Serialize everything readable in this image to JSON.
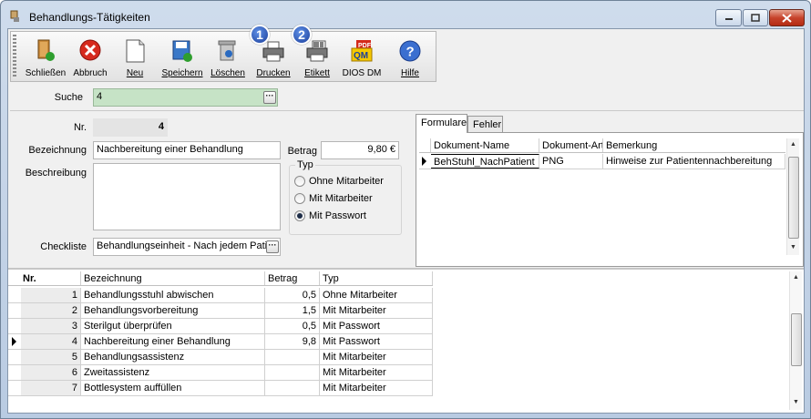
{
  "window": {
    "title": "Behandlungs-Tätigkeiten"
  },
  "toolbar": {
    "items": [
      {
        "label": "Schließen",
        "icon": "close-door-icon"
      },
      {
        "label": "Abbruch",
        "icon": "cancel-icon"
      },
      {
        "label": "Neu",
        "icon": "new-document-icon"
      },
      {
        "label": "Speichern",
        "icon": "save-icon"
      },
      {
        "label": "Löschen",
        "icon": "delete-icon"
      },
      {
        "label": "Drucken",
        "icon": "printer-icon",
        "badge": "1"
      },
      {
        "label": "Etikett",
        "icon": "label-printer-icon",
        "badge": "2"
      },
      {
        "label": "DIOS DM",
        "icon": "pdf-qm-icon"
      },
      {
        "label": "Hilfe",
        "icon": "help-icon"
      }
    ]
  },
  "search": {
    "label": "Suche",
    "value": "4"
  },
  "form": {
    "nr_label": "Nr.",
    "nr_value": "4",
    "bezeichnung_label": "Bezeichnung",
    "bezeichnung_value": "Nachbereitung einer Behandlung",
    "betrag_label": "Betrag",
    "betrag_value": "9,80 €",
    "beschreibung_label": "Beschreibung",
    "beschreibung_value": "",
    "typ_label": "Typ",
    "typ_options": [
      "Ohne Mitarbeiter",
      "Mit Mitarbeiter",
      "Mit Passwort"
    ],
    "typ_selected": "Mit Passwort",
    "checkliste_label": "Checkliste",
    "checkliste_value": "Behandlungseinheit - Nach jedem Patie"
  },
  "doc_tabs": {
    "tabs": [
      "Formulare",
      "Fehler"
    ],
    "active": "Formulare",
    "columns": [
      "Dokument-Name",
      "Dokument-Art",
      "Bemerkung"
    ],
    "rows": [
      {
        "name": "BehStuhl_NachPatient",
        "art": "PNG",
        "bemerkung": "Hinweise zur Patientennachbereitung"
      }
    ]
  },
  "list": {
    "columns": [
      "Nr.",
      "Bezeichnung",
      "Betrag",
      "Typ"
    ],
    "rows": [
      {
        "nr": "1",
        "bez": "Behandlungsstuhl abwischen",
        "betrag": "0,5",
        "typ": "Ohne Mitarbeiter"
      },
      {
        "nr": "2",
        "bez": "Behandlungsvorbereitung",
        "betrag": "1,5",
        "typ": "Mit Mitarbeiter"
      },
      {
        "nr": "3",
        "bez": "Sterilgut überprüfen",
        "betrag": "0,5",
        "typ": "Mit Passwort"
      },
      {
        "nr": "4",
        "bez": "Nachbereitung einer Behandlung",
        "betrag": "9,8",
        "typ": "Mit Passwort"
      },
      {
        "nr": "5",
        "bez": "Behandlungsassistenz",
        "betrag": "",
        "typ": "Mit Mitarbeiter"
      },
      {
        "nr": "6",
        "bez": "Zweitassistenz",
        "betrag": "",
        "typ": "Mit Mitarbeiter"
      },
      {
        "nr": "7",
        "bez": "Bottlesystem auffüllen",
        "betrag": "",
        "typ": "Mit Mitarbeiter"
      }
    ],
    "selected_nr": "4"
  }
}
